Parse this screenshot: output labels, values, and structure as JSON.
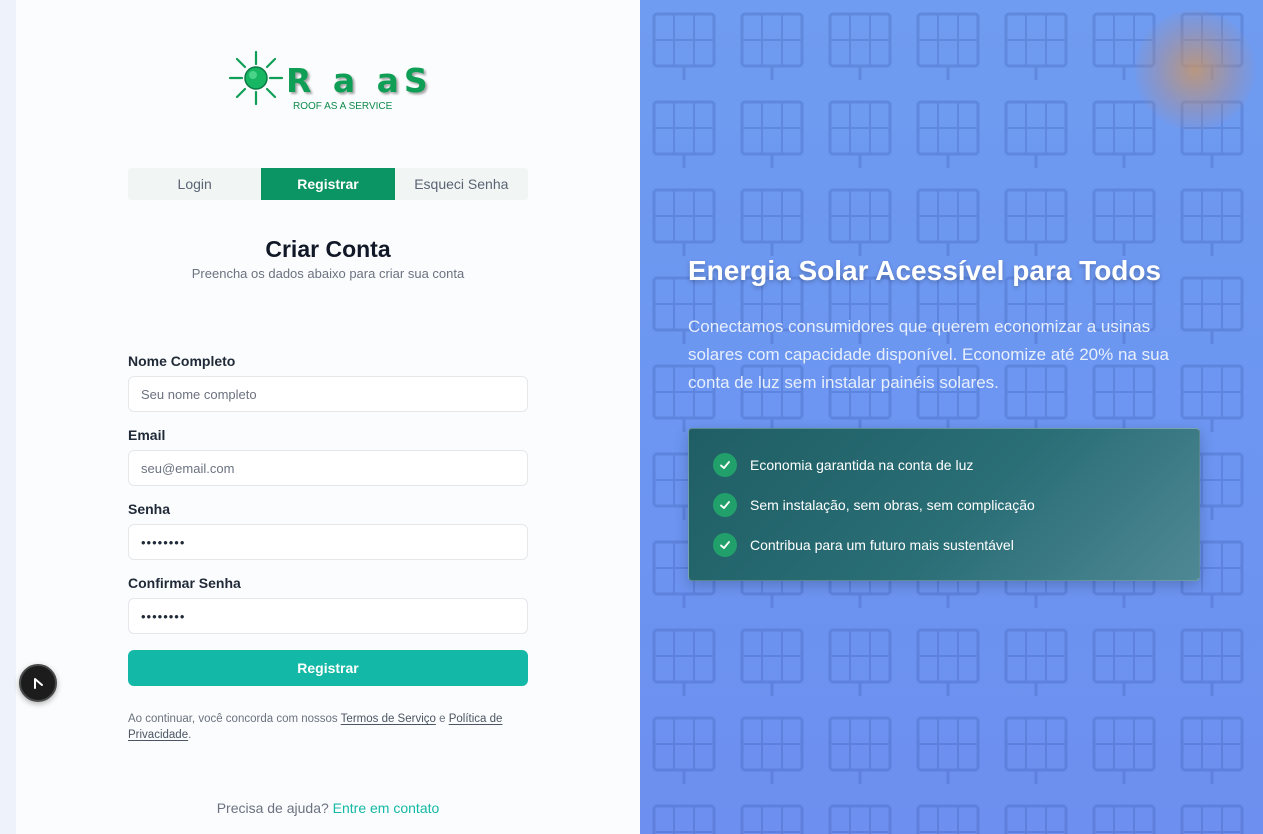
{
  "brand": {
    "wordmark": "R a aS",
    "tagline": "ROOF AS A SERVICE",
    "logo_color": "#0f9e55"
  },
  "tabs": [
    {
      "label": "Login",
      "active": false
    },
    {
      "label": "Registrar",
      "active": true
    },
    {
      "label": "Esqueci Senha",
      "active": false
    }
  ],
  "form": {
    "title": "Criar Conta",
    "subtitle": "Preencha os dados abaixo para criar sua conta",
    "fields": {
      "name": {
        "label": "Nome Completo",
        "placeholder": "Seu nome completo",
        "value": ""
      },
      "email": {
        "label": "Email",
        "placeholder": "seu@email.com",
        "value": ""
      },
      "password": {
        "label": "Senha",
        "placeholder": "",
        "value": "••••••••"
      },
      "confirm": {
        "label": "Confirmar Senha",
        "placeholder": "",
        "value": "••••••••"
      }
    },
    "submit_label": "Registrar",
    "terms": {
      "prefix": "Ao continuar, você concorda com nossos ",
      "terms_link": "Termos de Serviço",
      "conjunction": " e ",
      "privacy_link": "Política de Privacidade",
      "suffix": "."
    },
    "help": {
      "text": "Precisa de ajuda? ",
      "link": "Entre em contato"
    }
  },
  "hero": {
    "title": "Energia Solar Acessível para Todos",
    "text": "Conectamos consumidores que querem economizar a usinas solares com capacidade disponível. Economize até 20% na sua conta de luz sem instalar painéis solares.",
    "features": [
      "Economia garantida na conta de luz",
      "Sem instalação, sem obras, sem complicação",
      "Contribua para um futuro mais sustentável"
    ]
  },
  "colors": {
    "primary": "#0b9464",
    "button": "#14b8a6",
    "hero_bg": "#6f9bf0",
    "feature_card": "#1f5e64",
    "check": "#22a06b"
  },
  "icons": {
    "logo": "sun-icon",
    "feature": "check-icon",
    "floating": "navigation-arrow-icon"
  }
}
